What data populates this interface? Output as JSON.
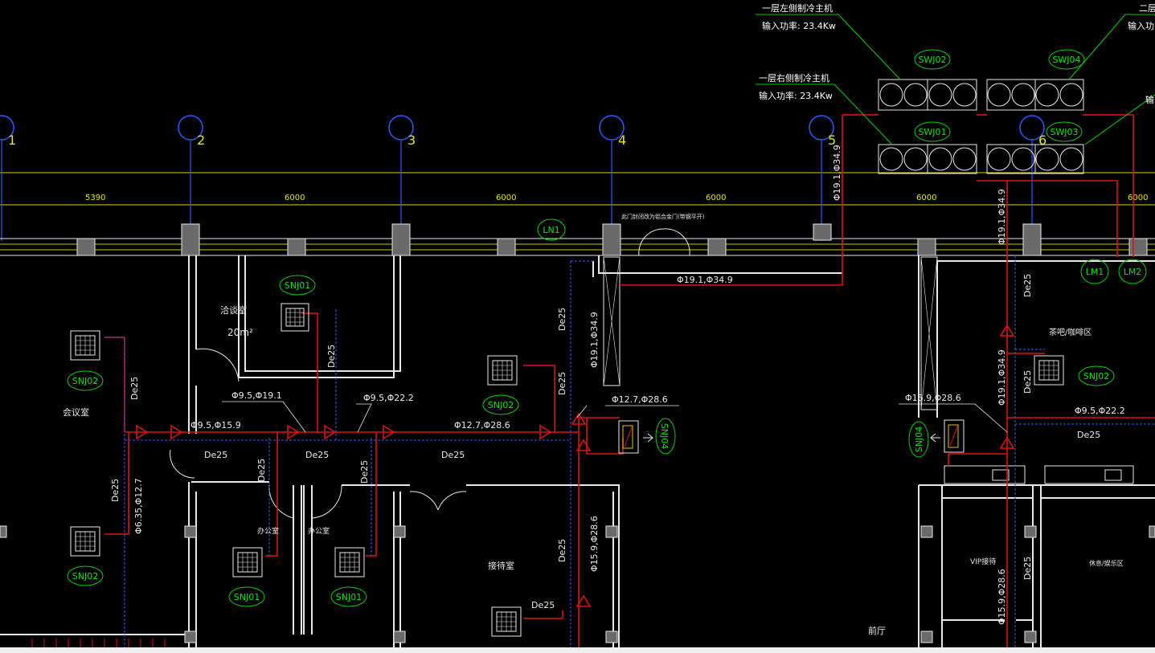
{
  "chillers": {
    "left_title": "一层左侧制冷主机",
    "left_power": "输入功率: 23.4Kw",
    "right_title": "一层右侧制冷主机",
    "right_power": "输入功率: 23.4Kw",
    "second_title_partial": "二层",
    "second_power_partial": "输入功",
    "third_power_partial": "输"
  },
  "unit_tags": {
    "swj01": "SWJ01",
    "swj02": "SWJ02",
    "swj03": "SWJ03",
    "swj04": "SWJ04",
    "snj01": "SNJ01",
    "snj02": "SNJ02",
    "snj04": "SNJ04",
    "ln1": "LN1",
    "lm1": "LM1",
    "lm2": "LM2"
  },
  "grid_axes": [
    "1",
    "2",
    "3",
    "4",
    "5",
    "6"
  ],
  "dimensions": [
    "5390",
    "6000",
    "6000",
    "6000",
    "6000",
    "6000"
  ],
  "pipe_labels": {
    "main_h": "Φ19.1,Φ34.9",
    "main_v1": "Φ19.1,Φ34.9",
    "main_v2": "Φ19.1,Φ34.9",
    "main_v3": "Φ19.1,Φ34.9",
    "main_v4": "Φ19.1,Φ34.9",
    "p_9_5_19_1": "Φ9.5,Φ19.1",
    "p_9_5_22_2": "Φ9.5,Φ22.2",
    "p_9_5_15_9": "Φ9.5,Φ15.9",
    "p_12_7_28_6": "Φ12.7,Φ28.6",
    "p_12_7_28_6_b": "Φ12.7,Φ28.6",
    "p_15_9_28_6": "Φ15.9,Φ28.6",
    "p_15_9_28_6_v": "Φ15.9,Φ28.6",
    "p_15_9_28_6_v2": "Φ15.9,Φ28.6",
    "p_9_5_22_2_r": "Φ9.5,Φ22.2",
    "p_6_35_12_7": "Φ6.35,Φ12.7"
  },
  "drain": "De25",
  "rooms": {
    "meeting_small": "洽谈室",
    "area": "20m²",
    "meeting": "会议室",
    "office1": "办公室",
    "office2": "办公室",
    "reception": "接待室",
    "bar": "茶吧/咖啡区",
    "vip": "VIP接待",
    "rest": "休息/娱乐区",
    "lobby": "前厅"
  },
  "door_note": "此门封闭改为铝合金门(带钢平开)"
}
